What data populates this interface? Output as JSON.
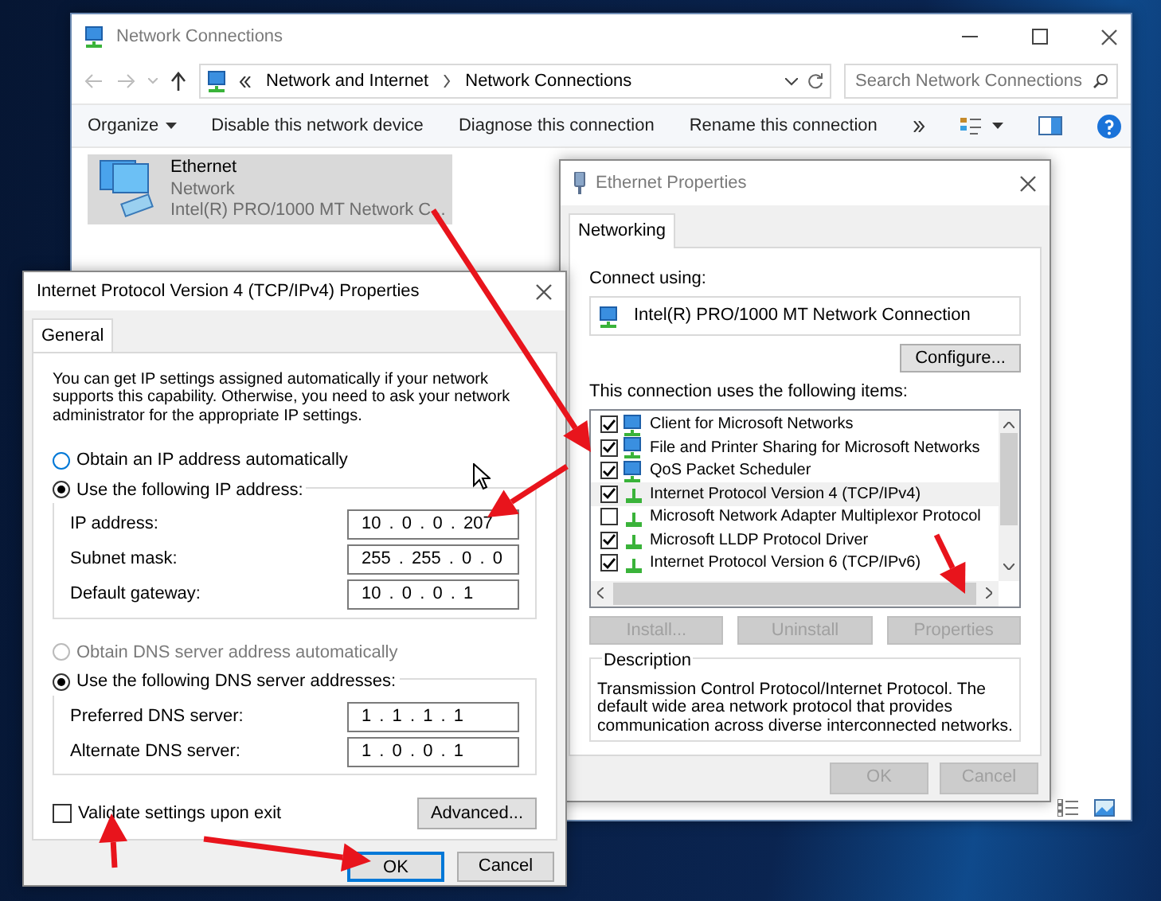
{
  "explorer": {
    "title": "Network Connections",
    "breadcrumb": [
      "Network and Internet",
      "Network Connections"
    ],
    "search": {
      "placeholder": "Search Network Connections"
    },
    "toolbar": [
      {
        "label": "Organize",
        "dropdown": true
      },
      {
        "label": "Disable this network device",
        "dropdown": false
      },
      {
        "label": "Diagnose this connection",
        "dropdown": false
      },
      {
        "label": "Rename this connection",
        "dropdown": false
      }
    ],
    "items": [
      {
        "name": "Ethernet",
        "status": "Network",
        "device": "Intel(R) PRO/1000 MT Network C...",
        "selected": true
      }
    ]
  },
  "ethernet_properties": {
    "title": "Ethernet Properties",
    "tabs": [
      {
        "label": "Networking",
        "selected": true
      }
    ],
    "connect_using_label": "Connect using:",
    "adapter": "Intel(R) PRO/1000 MT Network Connection",
    "configure_button": "Configure...",
    "items_label": "This connection uses the following items:",
    "components": [
      {
        "label": "Client for Microsoft Networks",
        "kind": "client",
        "checked": true,
        "selected": false
      },
      {
        "label": "File and Printer Sharing for Microsoft Networks",
        "kind": "client",
        "checked": true,
        "selected": false
      },
      {
        "label": "QoS Packet Scheduler",
        "kind": "client",
        "checked": true,
        "selected": false
      },
      {
        "label": "Internet Protocol Version 4 (TCP/IPv4)",
        "kind": "protocol",
        "checked": true,
        "selected": true
      },
      {
        "label": "Microsoft Network Adapter Multiplexor Protocol",
        "kind": "protocol",
        "checked": false,
        "selected": false
      },
      {
        "label": "Microsoft LLDP Protocol Driver",
        "kind": "protocol",
        "checked": true,
        "selected": false
      },
      {
        "label": "Internet Protocol Version 6 (TCP/IPv6)",
        "kind": "protocol",
        "checked": true,
        "selected": false
      }
    ],
    "buttons": [
      {
        "label": "Install...",
        "disabled": true
      },
      {
        "label": "Uninstall",
        "disabled": true
      },
      {
        "label": "Properties",
        "disabled": true
      }
    ],
    "description_title": "Description",
    "description": "Transmission Control Protocol/Internet Protocol. The default wide area network protocol that provides communication across diverse interconnected networks.",
    "footer_buttons": [
      {
        "label": "OK",
        "disabled": true
      },
      {
        "label": "Cancel",
        "disabled": true
      }
    ]
  },
  "ipv4_properties": {
    "title": "Internet Protocol Version 4 (TCP/IPv4) Properties",
    "tabs": [
      {
        "label": "General",
        "selected": true
      }
    ],
    "intro": "You can get IP settings assigned automatically if your network supports this capability. Otherwise, you need to ask your network administrator for the appropriate IP settings.",
    "ip_auto": {
      "label": "Obtain an IP address automatically",
      "selected": false,
      "disabled": false
    },
    "ip_manual": {
      "label": "Use the following IP address:",
      "selected": true,
      "disabled": false
    },
    "ip_fields": [
      {
        "label": "IP address:",
        "value": "10 . 0 . 0 . 207"
      },
      {
        "label": "Subnet mask:",
        "value": "255 . 255 . 0 . 0"
      },
      {
        "label": "Default gateway:",
        "value": "10 . 0 . 0 . 1"
      }
    ],
    "dns_auto": {
      "label": "Obtain DNS server address automatically",
      "selected": false,
      "disabled": true
    },
    "dns_manual": {
      "label": "Use the following DNS server addresses:",
      "selected": true,
      "disabled": false
    },
    "dns_fields": [
      {
        "label": "Preferred DNS server:",
        "value": "1 . 1 . 1 . 1"
      },
      {
        "label": "Alternate DNS server:",
        "value": "1 . 0 . 0 . 1"
      }
    ],
    "validate": {
      "label": "Validate settings upon exit",
      "checked": false
    },
    "advanced_button": "Advanced...",
    "buttons": [
      {
        "label": "OK",
        "default": true
      },
      {
        "label": "Cancel",
        "default": false
      }
    ]
  }
}
